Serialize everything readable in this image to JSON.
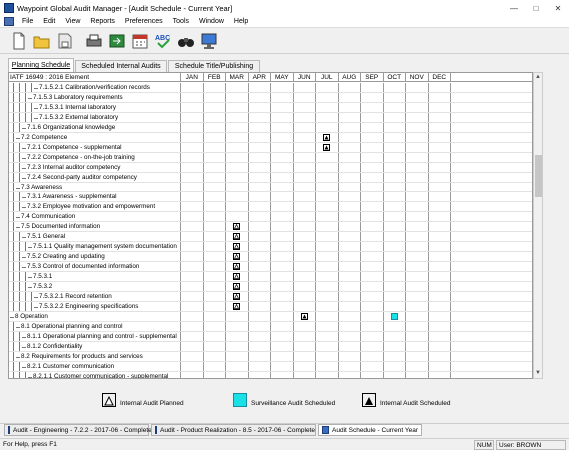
{
  "window": {
    "title": "Waypoint Global Audit Manager - [Audit Schedule - Current Year]",
    "controls": [
      "—",
      "□",
      "✕"
    ]
  },
  "menu": [
    "File",
    "Edit",
    "View",
    "Reports",
    "Preferences",
    "Tools",
    "Window",
    "Help"
  ],
  "toolbar": [
    "new-document-icon",
    "open-folder-icon",
    "save-icon",
    "print-icon",
    "export-icon",
    "calendar-icon",
    "spell-check-icon",
    "binoculars-icon",
    "monitor-icon"
  ],
  "tabs": [
    {
      "label": "Planning Schedule",
      "active": true
    },
    {
      "label": "Scheduled Internal Audits",
      "active": false
    },
    {
      "label": "Schedule Title/Publishing",
      "active": false
    }
  ],
  "grid": {
    "header": "IATF 16949 : 2016 Element",
    "months": [
      "JAN",
      "FEB",
      "MAR",
      "APR",
      "MAY",
      "JUN",
      "JUL",
      "AUG",
      "SEP",
      "OCT",
      "NOV",
      "DEC"
    ],
    "rows": [
      {
        "label": "7.1.5.2.1 Calibration/verification records",
        "level": 4,
        "marks": []
      },
      {
        "label": "7.1.5.3 Laboratory requirements",
        "level": 3,
        "marks": []
      },
      {
        "label": "7.1.5.3.1 Internal laboratory",
        "level": 4,
        "marks": []
      },
      {
        "label": "7.1.5.3.2 External laboratory",
        "level": 4,
        "marks": []
      },
      {
        "label": "7.1.6 Organizational knowledge",
        "level": 2,
        "marks": []
      },
      {
        "label": "7.2 Competence",
        "level": 1,
        "marks": [
          {
            "month": 6,
            "type": "scheduled"
          }
        ]
      },
      {
        "label": "7.2.1 Competence - supplemental",
        "level": 2,
        "marks": [
          {
            "month": 6,
            "type": "scheduled"
          }
        ]
      },
      {
        "label": "7.2.2 Competence - on-the-job training",
        "level": 2,
        "marks": []
      },
      {
        "label": "7.2.3 Internal auditor competency",
        "level": 2,
        "marks": []
      },
      {
        "label": "7.2.4 Second-party auditor competency",
        "level": 2,
        "marks": []
      },
      {
        "label": "7.3 Awareness",
        "level": 1,
        "marks": []
      },
      {
        "label": "7.3.1 Awareness - supplemental",
        "level": 2,
        "marks": []
      },
      {
        "label": "7.3.2 Employee motivation and empowerment",
        "level": 2,
        "marks": []
      },
      {
        "label": "7.4 Communication",
        "level": 1,
        "marks": []
      },
      {
        "label": "7.5 Documented information",
        "level": 1,
        "marks": [
          {
            "month": 2,
            "type": "planned"
          }
        ]
      },
      {
        "label": "7.5.1 General",
        "level": 2,
        "marks": [
          {
            "month": 2,
            "type": "planned"
          }
        ]
      },
      {
        "label": "7.5.1.1 Quality management system documentation",
        "level": 3,
        "marks": [
          {
            "month": 2,
            "type": "planned"
          }
        ]
      },
      {
        "label": "7.5.2 Creating and updating",
        "level": 2,
        "marks": [
          {
            "month": 2,
            "type": "planned"
          }
        ]
      },
      {
        "label": "7.5.3 Control of documented information",
        "level": 2,
        "marks": [
          {
            "month": 2,
            "type": "planned"
          }
        ]
      },
      {
        "label": "7.5.3.1",
        "level": 3,
        "marks": [
          {
            "month": 2,
            "type": "planned"
          }
        ]
      },
      {
        "label": "7.5.3.2",
        "level": 3,
        "marks": [
          {
            "month": 2,
            "type": "planned"
          }
        ]
      },
      {
        "label": "7.5.3.2.1 Record retention",
        "level": 4,
        "marks": [
          {
            "month": 2,
            "type": "planned"
          }
        ]
      },
      {
        "label": "7.5.3.2.2 Engineering specifications",
        "level": 4,
        "marks": [
          {
            "month": 2,
            "type": "planned"
          }
        ]
      },
      {
        "label": "8 Operation",
        "level": 0,
        "marks": [
          {
            "month": 5,
            "type": "scheduled"
          },
          {
            "month": 9,
            "type": "surveillance"
          }
        ]
      },
      {
        "label": "8.1 Operational planning and control",
        "level": 1,
        "marks": []
      },
      {
        "label": "8.1.1 Operational planning and control - supplemental",
        "level": 2,
        "marks": []
      },
      {
        "label": "8.1.2 Confidentiality",
        "level": 2,
        "marks": []
      },
      {
        "label": "8.2 Requirements for products and services",
        "level": 1,
        "marks": []
      },
      {
        "label": "8.2.1 Customer communication",
        "level": 2,
        "marks": []
      },
      {
        "label": "8.2.1.1 Customer communication - supplemental",
        "level": 3,
        "marks": []
      }
    ]
  },
  "legend": {
    "planned": "Internal Audit Planned",
    "surveillance": "Surveillance Audit Scheduled",
    "scheduled": "Internal Audit Scheduled"
  },
  "colors": {
    "surveillance": "#19e1e6"
  },
  "doc_tabs": [
    "Audit - Engineering - 7.2.2 - 2017-06 - Complete",
    "Audit - Product Realization - 8.5 - 2017-06 - Complete",
    "Audit Schedule - Current Year"
  ],
  "status": {
    "help": "For Help, press F1",
    "num": "NUM",
    "user": "User: BROWN"
  }
}
